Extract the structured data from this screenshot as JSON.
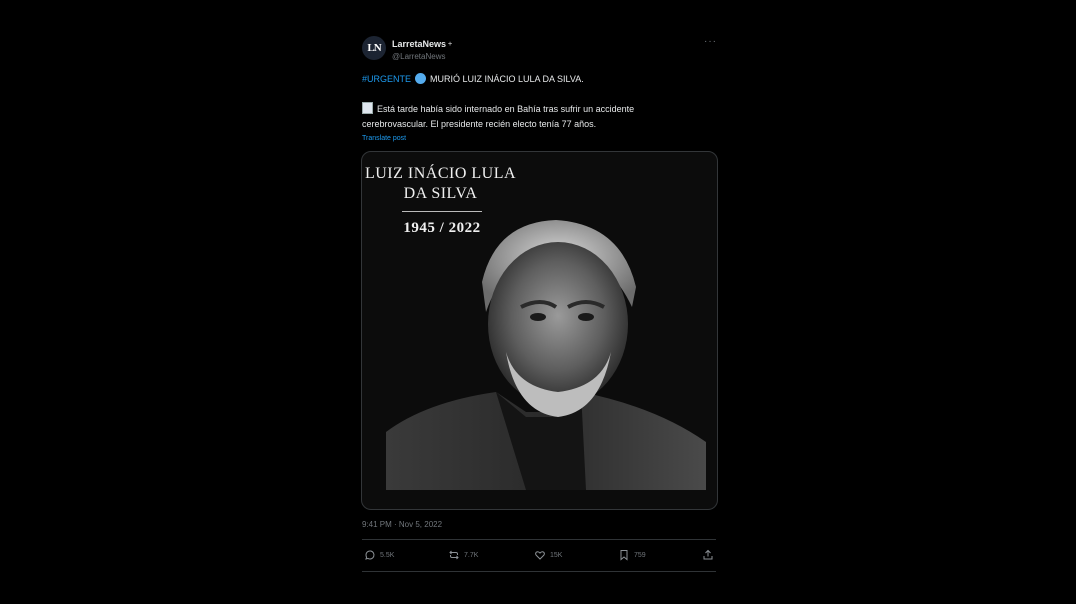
{
  "account": {
    "avatar_text": "LN",
    "name": "LarretaNews",
    "verified_mark": "+",
    "handle": "@LarretaNews"
  },
  "tweet": {
    "hashtag": "#URGENTE",
    "headline": "MURIÓ LUIZ INÁCIO LULA DA SILVA.",
    "body": "Está tarde había sido internado en Bahía tras sufrir un accidente cerebrovascular. El presidente recién electo tenía 77 años.",
    "translate_label": "Translate post",
    "timestamp": "9:41 PM · Nov 5, 2022"
  },
  "media": {
    "title_line1": "LUIZ INÁCIO LULA",
    "title_line2": "DA SILVA",
    "years": "1945 / 2022"
  },
  "actions": {
    "replies": "5.5K",
    "reposts": "7.7K",
    "likes": "15K",
    "bookmarks": "759"
  },
  "icons": {
    "more": "more-icon",
    "reply": "reply-icon",
    "repost": "repost-icon",
    "like": "heart-icon",
    "bookmark": "bookmark-icon",
    "share": "share-icon"
  },
  "colors": {
    "background": "#000000",
    "link": "#1d9bf0",
    "muted": "#71767b",
    "text": "#e7e9ea"
  }
}
